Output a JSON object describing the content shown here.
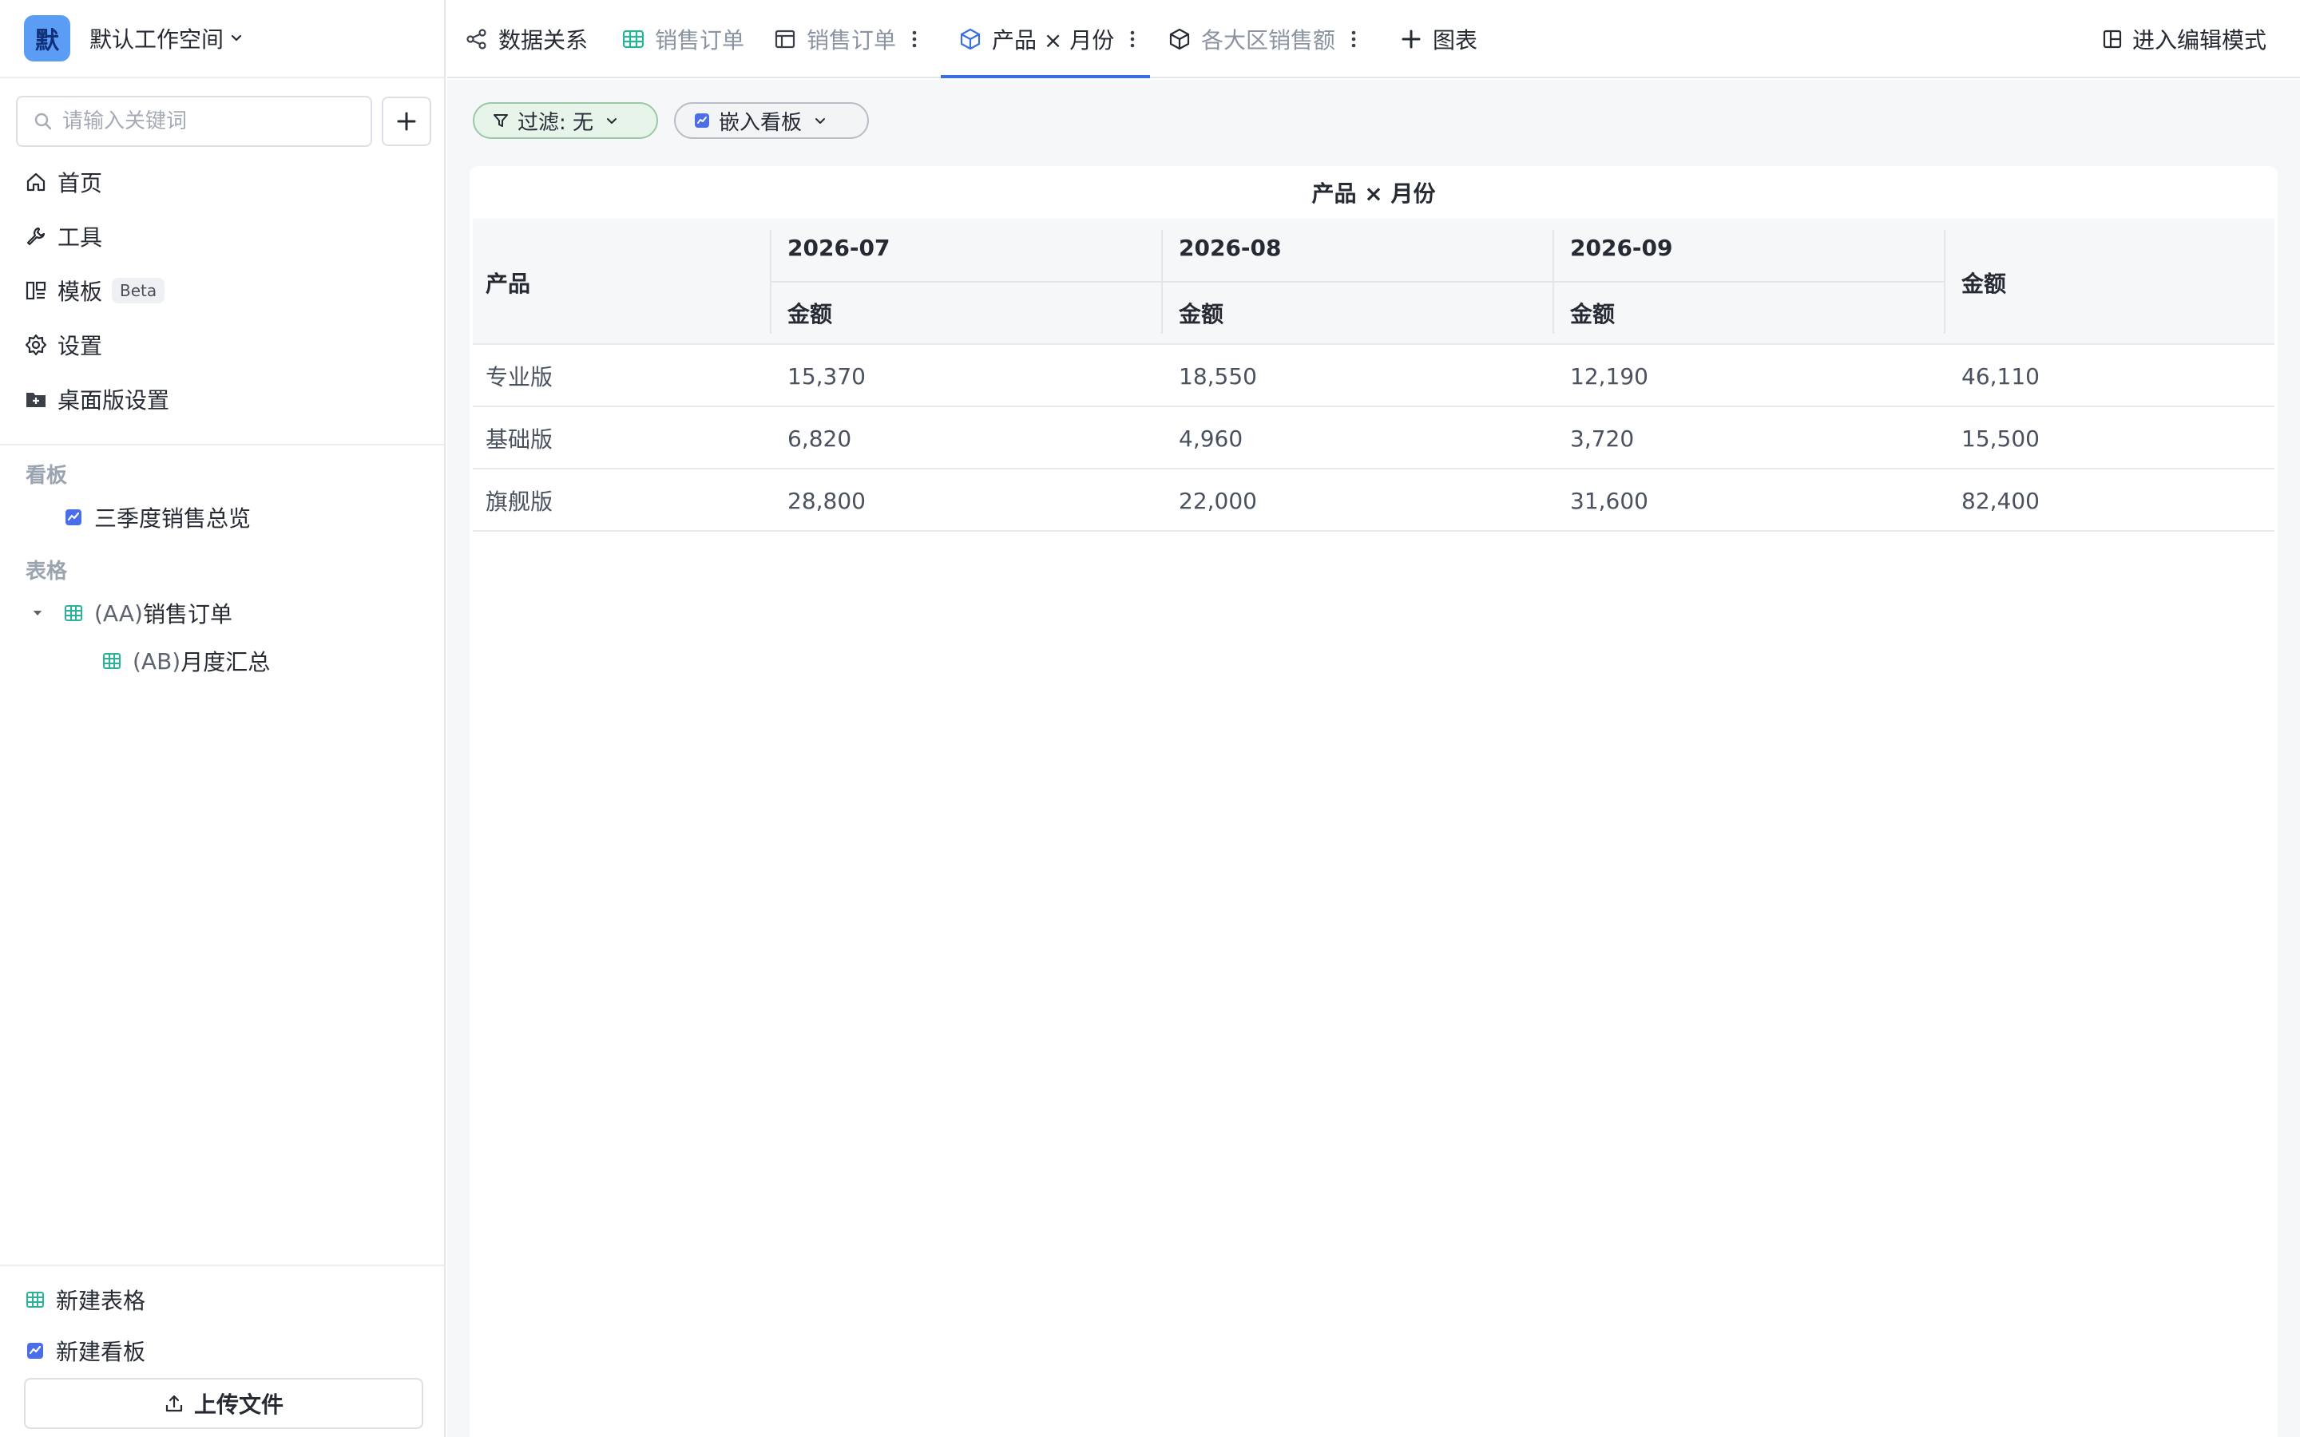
{
  "workspace": {
    "avatar": "默",
    "name": "默认工作空间"
  },
  "search": {
    "placeholder": "请输入关键词"
  },
  "nav": [
    {
      "label": "首页",
      "icon": "home-icon"
    },
    {
      "label": "工具",
      "icon": "wrench-icon"
    },
    {
      "label": "模板",
      "icon": "template-icon",
      "badge": "Beta"
    },
    {
      "label": "设置",
      "icon": "gear-icon"
    },
    {
      "label": "桌面版设置",
      "icon": "desktop-folder-icon"
    }
  ],
  "sections": {
    "boards_title": "看板",
    "boards": [
      {
        "label": "三季度销售总览"
      }
    ],
    "tables_title": "表格",
    "tables": [
      {
        "prefix": "(AA)",
        "label": "销售订单"
      },
      {
        "prefix": "(AB)",
        "label": "月度汇总"
      }
    ]
  },
  "bottom": {
    "new_table": "新建表格",
    "new_board": "新建看板",
    "upload": "上传文件"
  },
  "tabs": [
    {
      "label": "数据关系",
      "state": "normal"
    },
    {
      "label": "销售订单",
      "state": "muted"
    },
    {
      "label": "销售订单",
      "state": "muted"
    },
    {
      "label": "产品 × 月份",
      "state": "active"
    },
    {
      "label": "各大区销售额",
      "state": "muted"
    },
    {
      "label": "图表",
      "state": "normal"
    }
  ],
  "edit_mode": "进入编辑模式",
  "filters": {
    "filter": "过滤: 无",
    "embed": "嵌入看板"
  },
  "pivot": {
    "title": "产品 × 月份",
    "row_header": "产品",
    "months": [
      "2026-07",
      "2026-08",
      "2026-09"
    ],
    "measure": "金额",
    "total_header": "金额",
    "rows": [
      {
        "product": "专业版",
        "values": [
          "15,370",
          "18,550",
          "12,190"
        ],
        "total": "46,110"
      },
      {
        "product": "基础版",
        "values": [
          "6,820",
          "4,960",
          "3,720"
        ],
        "total": "15,500"
      },
      {
        "product": "旗舰版",
        "values": [
          "28,800",
          "22,000",
          "31,600"
        ],
        "total": "82,400"
      }
    ]
  },
  "colors": {
    "accent": "#3b6fe0",
    "table_green": "#2bb39a",
    "board_blue": "#4a6ee8"
  }
}
